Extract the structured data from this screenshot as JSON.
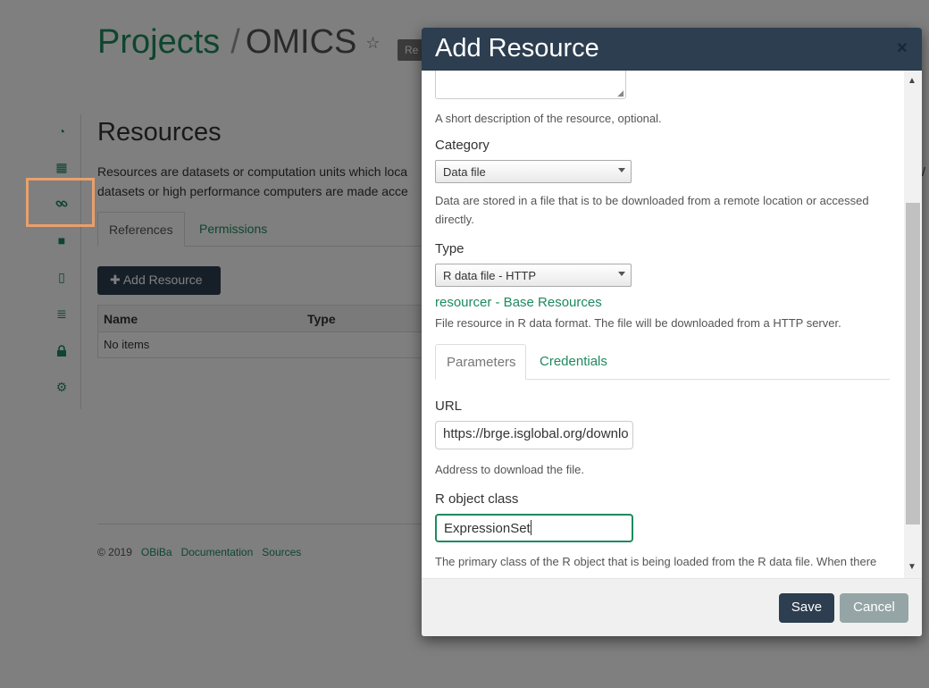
{
  "background": {
    "breadcrumb": {
      "projects": "Projects",
      "separator": "/",
      "project_name": "OMICS",
      "star": "☆",
      "badge": "Re"
    },
    "side_nav": {
      "items": [
        {
          "name": "dashboard-icon",
          "glyph": "◔"
        },
        {
          "name": "table-icon",
          "glyph": "▦"
        },
        {
          "name": "link-icon",
          "glyph": "🔗"
        },
        {
          "name": "folder-icon",
          "glyph": "■"
        },
        {
          "name": "file-icon",
          "glyph": "▯"
        },
        {
          "name": "list-icon",
          "glyph": "≣"
        },
        {
          "name": "lock-icon",
          "glyph": "🔒"
        },
        {
          "name": "gear-icon",
          "glyph": "⚙"
        }
      ]
    },
    "resources": {
      "heading": "Resources",
      "description_line1": "Resources are datasets or computation units which loca",
      "description_line2": "datasets or high performance computers are made acce",
      "description_right": "/",
      "tabs": {
        "references": "References",
        "permissions": "Permissions"
      },
      "add_button": "✚ Add Resource",
      "table": {
        "columns": [
          "Name",
          "Type"
        ],
        "empty": "No items"
      }
    },
    "footer": {
      "copyright": "© 2019",
      "obiba": "OBiBa",
      "documentation": "Documentation",
      "sources": "Sources"
    }
  },
  "modal": {
    "title": "Add Resource",
    "close": "×",
    "description_help": "A short description of the resource, optional.",
    "category": {
      "label": "Category",
      "selected": "Data file",
      "help": "Data are stored in a file that is to be downloaded from a remote location or accessed directly."
    },
    "type": {
      "label": "Type",
      "selected": "R data file - HTTP",
      "package_link": "resourcer - Base Resources",
      "help": "File resource in R data format. The file will be downloaded from a HTTP server."
    },
    "tabs": {
      "parameters": "Parameters",
      "credentials": "Credentials"
    },
    "url": {
      "label": "URL",
      "value": "https://brge.isglobal.org/downlo",
      "help": "Address to download the file."
    },
    "r_object_class": {
      "label": "R object class",
      "value": "ExpressionSet",
      "help": "The primary class of the R object that is being loaded from the R data file. When there are"
    },
    "footer": {
      "save": "Save",
      "cancel": "Cancel"
    }
  },
  "colors": {
    "accent": "#1e8a5f",
    "header": "#2c3e50",
    "cancel": "#95a5a6",
    "highlight": "#e8a06c"
  }
}
